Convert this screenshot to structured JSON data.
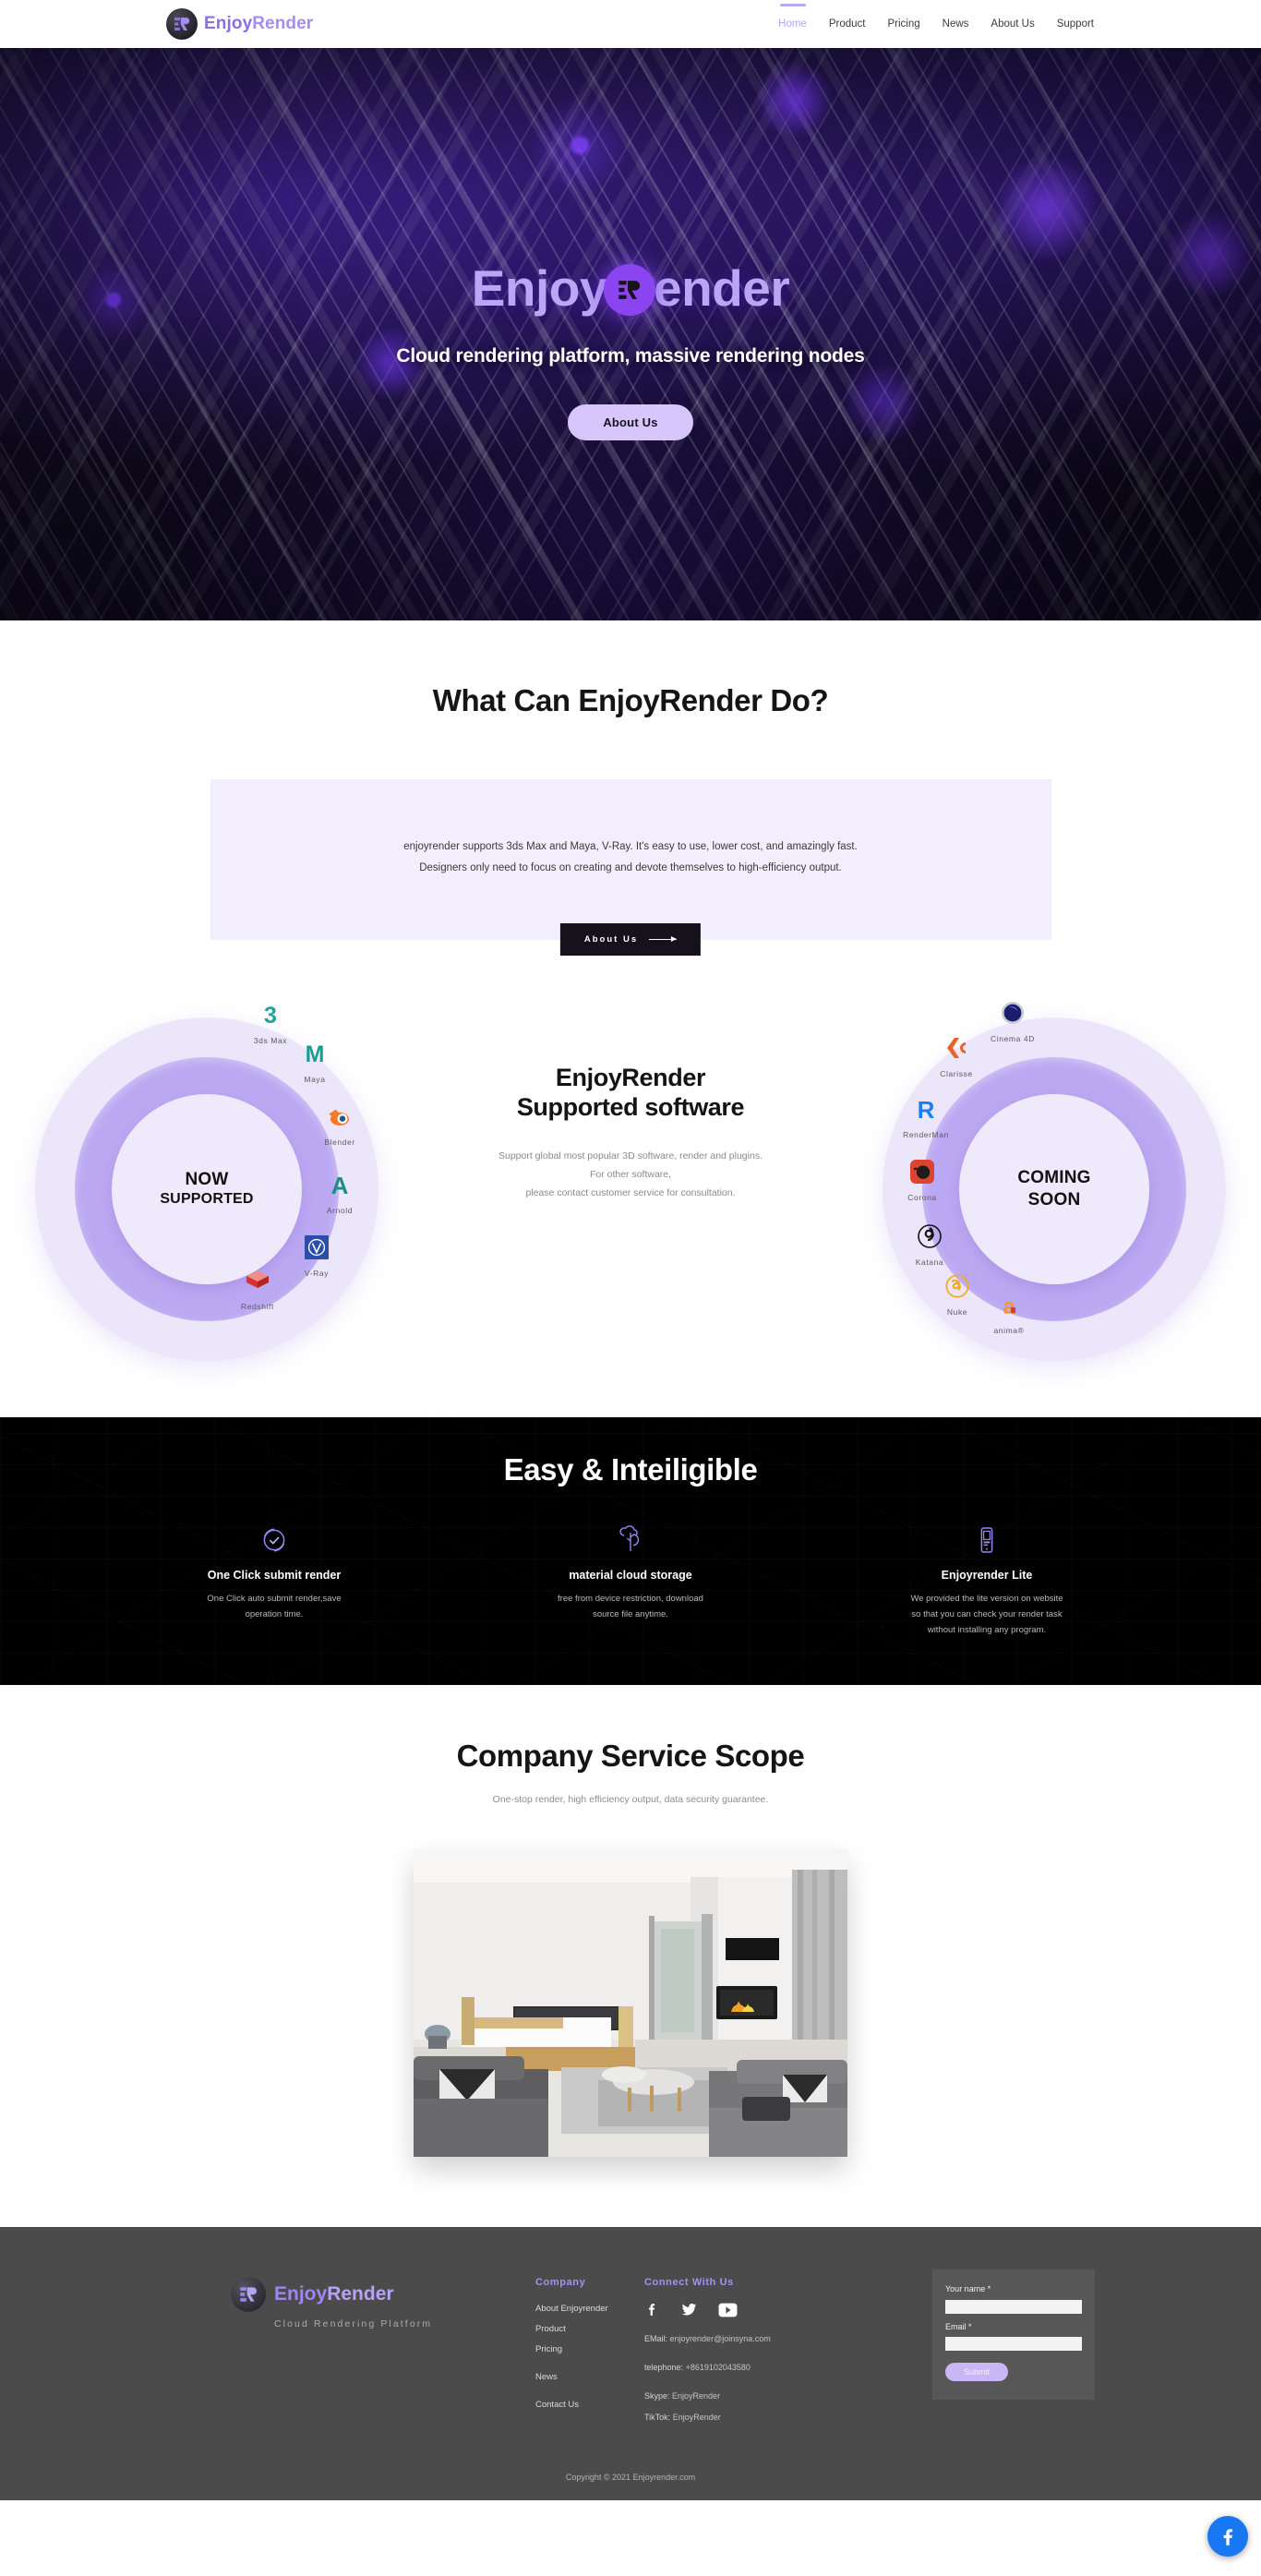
{
  "colors": {
    "accent_purple": "#8b45f0",
    "light_purple": "#b9a6f5",
    "ring_outer": "#ece6fb",
    "ring_mid": "#bba8f2",
    "ring_core": "#efeafb",
    "card_bg": "#f2eefd",
    "footer_bg": "#4b4b4b",
    "facebook_blue": "#1877f2"
  },
  "header": {
    "brand_part1": "Enjoy",
    "brand_part2": "Render",
    "logo_icon": "enjoyrender-logo-icon",
    "nav": [
      {
        "label": "Home",
        "active": true
      },
      {
        "label": "Product",
        "active": false
      },
      {
        "label": "Pricing",
        "active": false
      },
      {
        "label": "News",
        "active": false
      },
      {
        "label": "About Us",
        "active": false
      },
      {
        "label": "Support",
        "active": false
      }
    ]
  },
  "hero": {
    "title_part1": "Enjoy",
    "title_badge": "R",
    "title_part2": "ender",
    "subtitle": "Cloud rendering platform, massive rendering nodes",
    "cta": "About Us"
  },
  "floating": {
    "facebook_icon": "facebook-icon"
  },
  "what": {
    "heading": "What Can EnjoyRender Do?",
    "body_line1": "enjoyrender supports 3ds Max and Maya, V-Ray. It's easy to use, lower cost, and amazingly fast.",
    "body_line2": "Designers only need to focus on creating and devote themselves to high-efficiency output.",
    "cta": "About Us"
  },
  "software": {
    "heading_line1": "EnjoyRender",
    "heading_line2": "Supported software",
    "body_line1": "Support global most popular 3D software, render and plugins.",
    "body_line2": "For other software,",
    "body_line3": "please contact customer service for consultation.",
    "left_ring": {
      "title_line1": "NOW",
      "title_line2": "SUPPORTED",
      "items": [
        {
          "name": "3ds Max",
          "icon": "3dsmax-icon"
        },
        {
          "name": "Maya",
          "icon": "maya-icon"
        },
        {
          "name": "Blender",
          "icon": "blender-icon"
        },
        {
          "name": "Arnold",
          "icon": "arnold-icon"
        },
        {
          "name": "V-Ray",
          "icon": "vray-icon"
        },
        {
          "name": "Redshift",
          "icon": "redshift-icon"
        }
      ]
    },
    "right_ring": {
      "title_line1": "COMING",
      "title_line2": "SOON",
      "items": [
        {
          "name": "Cinema 4D",
          "icon": "cinema4d-icon"
        },
        {
          "name": "Clarisse",
          "icon": "clarisse-icon"
        },
        {
          "name": "RenderMan",
          "icon": "renderman-icon"
        },
        {
          "name": "Corona",
          "icon": "corona-icon"
        },
        {
          "name": "Katana",
          "icon": "katana-icon"
        },
        {
          "name": "Nuke",
          "icon": "nuke-icon"
        },
        {
          "name": "anima®",
          "icon": "anima-icon"
        }
      ]
    }
  },
  "easy": {
    "heading": "Easy & Inteiligible",
    "features": [
      {
        "icon": "check-shield-icon",
        "title": "One Click submit render",
        "desc_line1": "One Click auto submit render,save",
        "desc_line2": "operation time."
      },
      {
        "icon": "cloud-tree-icon",
        "title": "material cloud storage",
        "desc_line1": "free from device restriction, download",
        "desc_line2": "source file anytime."
      },
      {
        "icon": "mobile-phone-icon",
        "title": "Enjoyrender Lite",
        "desc_line1": "We provided the lite version on website",
        "desc_line2": "so that you can check your render task",
        "desc_line3": "without installing any program."
      }
    ]
  },
  "scope": {
    "heading": "Company Service Scope",
    "subtitle": "One-stop render, high efficiency output, data security guarantee.",
    "image_alt": "modern-living-room-render"
  },
  "footer": {
    "brand_part1": "Enjoy",
    "brand_part2": "Render",
    "tagline": "Cloud Rendering Platform",
    "company": {
      "heading": "Company",
      "links": [
        "About Enjoyrender",
        "Product",
        "Pricing",
        "News",
        "Contact Us"
      ]
    },
    "connect": {
      "heading": "Connect With Us",
      "socials": [
        {
          "icon": "facebook-icon"
        },
        {
          "icon": "twitter-icon"
        },
        {
          "icon": "youtube-icon"
        }
      ],
      "email_label": "EMail:",
      "email_value": "enjoyrender@joinsyna.com",
      "phone_label": "telephone:",
      "phone_value": "+8619102043580",
      "skype_label": "Skype:",
      "skype_value": "EnjoyRender",
      "tiktok_label": "TikTok:",
      "tiktok_value": "EnjoyRender"
    },
    "form": {
      "name_label": "Your name *",
      "name_value": "",
      "name_placeholder": "",
      "email_label": "Email *",
      "email_value": "",
      "email_placeholder": "",
      "submit": "Submit"
    },
    "copyright": "Copyright © 2021  Enjoyrender.com"
  }
}
